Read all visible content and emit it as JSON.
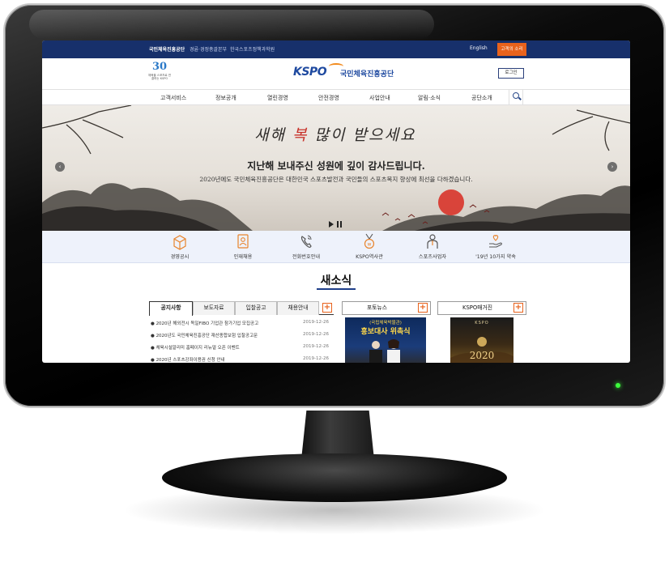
{
  "topbar": {
    "links": [
      "국민체육진흥공단",
      "경륜·경정총괄본부",
      "한국스포츠정책과학원"
    ],
    "english": "English",
    "voice_btn": "고객의 소리"
  },
  "header": {
    "anniversary_number": "30",
    "anniversary_text": "체육을 스포츠로 연결하는 KSPO",
    "logo_en": "KSPO",
    "logo_ko": "국민체육진흥공단",
    "login": "로그인"
  },
  "nav": {
    "items": [
      "고객서비스",
      "정보공개",
      "열린경영",
      "안전경영",
      "사업안내",
      "알림·소식",
      "공단소개"
    ]
  },
  "banner": {
    "calligraphy_pre": "새해 ",
    "calligraphy_red": "복",
    "calligraphy_post": " 많이 받으세요",
    "headline": "지난해 보내주신 성원에 깊이 감사드립니다.",
    "subtext": "2020년에도 국민체육진흥공단은 대한민국 스포츠발전과 국민들의 스포츠복지 향상에 최선을 다하겠습니다.",
    "prev": "‹",
    "next": "›"
  },
  "quick_links": [
    {
      "label": "경영공시",
      "icon": "box-icon"
    },
    {
      "label": "인재채용",
      "icon": "person-document-icon"
    },
    {
      "label": "전화번호안내",
      "icon": "phone-icon"
    },
    {
      "label": "KSPO역사관",
      "icon": "medal-icon"
    },
    {
      "label": "스포츠사업자",
      "icon": "person-icon"
    },
    {
      "label": "'19년 10가지 약속",
      "icon": "heart-hand-icon"
    }
  ],
  "news": {
    "title": "새소식",
    "tabs": [
      "공지사항",
      "보도자료",
      "입찰공고",
      "채용안내"
    ],
    "plus": "+",
    "items": [
      {
        "title": "2020년 해외전시 독일FIBO 기업관 참가기업 모집공고",
        "date": "2019-12-26"
      },
      {
        "title": "2020년도 국민체육진흥공단 재산종합보험 입찰공고문",
        "date": "2019-12-26"
      },
      {
        "title": "체육시설알리미 홈페이지 리뉴얼 오픈 이벤트",
        "date": "2019-12-26"
      },
      {
        "title": "2020년 스포츠강좌이용권 신청 안내",
        "date": "2019-12-26"
      }
    ]
  },
  "photo_news": {
    "title": "포토뉴스",
    "caption_small": "(국립체육박물관)",
    "caption_large": "홍보대사 위촉식"
  },
  "kspo_magazine": {
    "title": "KSPO매거진",
    "cover_title": "KSPO",
    "cover_year": "2020"
  }
}
